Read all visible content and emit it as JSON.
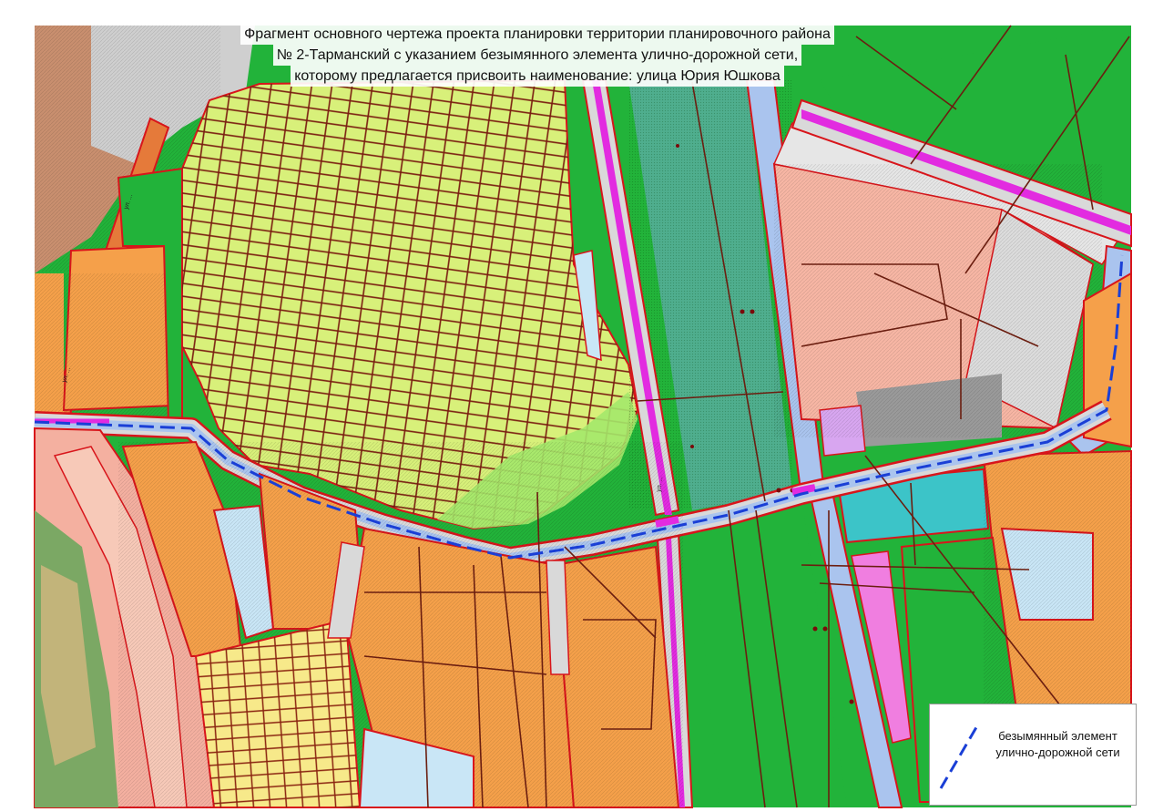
{
  "map": {
    "title_lines": [
      "Фрагмент основного чертежа проекта планировки территории планировочного района",
      "№ 2-Тарманский с указанием безымянного элемента улично-дорожной сети,",
      "которому предлагается присвоить наименование: улица Юрия Юшкова"
    ],
    "legend": {
      "symbol": "dashed-blue-line",
      "line_color": "#1a3fd6",
      "label_lines": [
        "безымянный элемент",
        "улично-дорожной сети"
      ]
    },
    "colors": {
      "residential_orange": "#f5a04a",
      "garden_plots": "#d8f07a",
      "green_zone": "#22b33a",
      "rail_zone": "#4fae8e",
      "commercial_pink": "#f7b6a4",
      "road_grey": "#d9d9d9",
      "road_blue": "#aac4ee",
      "pedestrian_magenta": "#e22be0",
      "water_light_blue": "#c9e6f6",
      "cyan_zone": "#3cc4c8",
      "lilac_zone": "#d8a6f0",
      "boundary_red": "#d8151b",
      "parcel_brown": "#6b1e10"
    }
  }
}
